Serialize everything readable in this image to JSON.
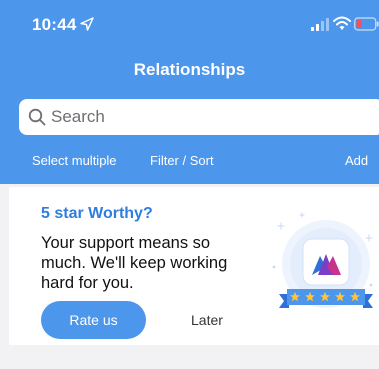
{
  "status_bar": {
    "time": "10:44",
    "icons": [
      "location-arrow-icon",
      "signal-icon",
      "wifi-icon",
      "battery-icon"
    ]
  },
  "nav": {
    "title": "Relationships"
  },
  "search": {
    "placeholder": "Search"
  },
  "toolbar": {
    "select_multiple": "Select multiple",
    "filter_sort": "Filter / Sort",
    "add": "Add"
  },
  "rating_card": {
    "title": "5 star Worthy?",
    "message": "Your support means so much. We'll keep working hard for you.",
    "rate_label": "Rate us",
    "later_label": "Later",
    "star_count": 5
  },
  "colors": {
    "brand_blue": "#4c96ec",
    "title_blue": "#2f7de0",
    "battery_red": "#f0515d",
    "star_yellow": "#ffc53a",
    "background": "#f2f2f4"
  }
}
